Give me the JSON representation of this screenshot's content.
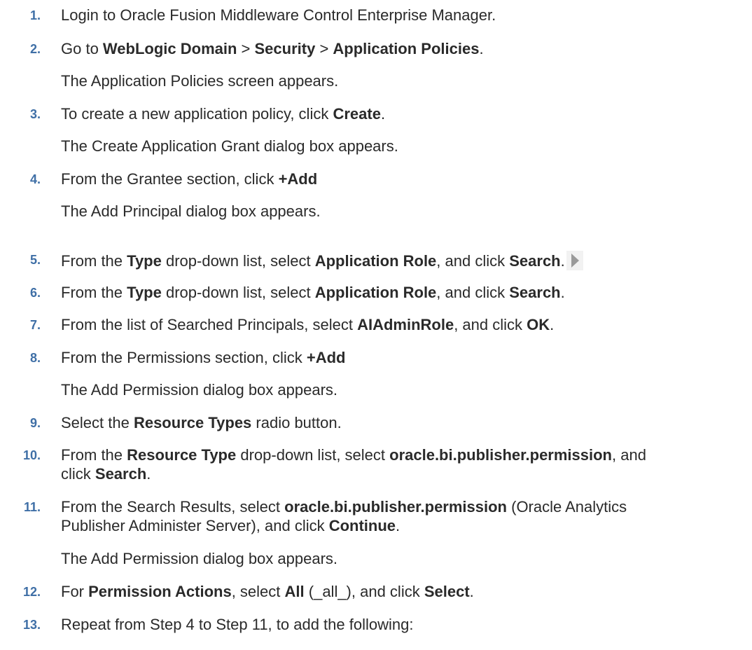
{
  "steps": [
    {
      "num": "1.",
      "parts": [
        "Login to Oracle Fusion Middleware Control Enterprise Manager."
      ]
    },
    {
      "num": "2.",
      "parts": [
        "Go to ",
        "WebLogic Domain",
        " > ",
        "Security",
        " > ",
        "Application Policies",
        "."
      ],
      "sub": "The Application Policies screen appears."
    },
    {
      "num": "3.",
      "parts": [
        "To create a new application policy, click ",
        "Create",
        "."
      ],
      "sub": "The Create Application Grant dialog box appears."
    },
    {
      "num": "4.",
      "parts": [
        "From the Grantee section, click ",
        "+Add"
      ],
      "sub": "The Add Principal dialog box appears."
    },
    {
      "num": "5.",
      "parts": [
        "From the ",
        "Type",
        " drop-down list, select ",
        "Application Role",
        ", and click ",
        "Search",
        "."
      ]
    },
    {
      "num": "6.",
      "parts": [
        "From the ",
        "Type",
        " drop-down list, select ",
        "Application Role",
        ", and click ",
        "Search",
        "."
      ]
    },
    {
      "num": "7.",
      "parts": [
        "From the list of Searched Principals, select ",
        "AIAdminRole",
        ", and click ",
        "OK",
        "."
      ]
    },
    {
      "num": "8.",
      "parts": [
        "From the Permissions section, click ",
        "+Add"
      ],
      "sub": "The Add Permission dialog box appears."
    },
    {
      "num": "9.",
      "parts": [
        "Select the ",
        "Resource Types",
        " radio button."
      ]
    },
    {
      "num": "10.",
      "parts": [
        "From the ",
        "Resource Type",
        " drop-down list, select ",
        "oracle.bi.publisher.permission",
        ", and"
      ],
      "parts2": [
        "click ",
        "Search",
        "."
      ]
    },
    {
      "num": "11.",
      "parts": [
        "From the Search Results, select ",
        "oracle.bi.publisher.permission",
        " (Oracle Analytics"
      ],
      "parts2": [
        "Publisher Administer Server), and click ",
        "Continue",
        "."
      ],
      "sub": "The Add Permission dialog box appears."
    },
    {
      "num": "12.",
      "parts": [
        "For ",
        "Permission Actions",
        ", select ",
        "All",
        " (_all_), and click ",
        "Select",
        "."
      ]
    },
    {
      "num": "13.",
      "parts": [
        "Repeat from Step 4 to Step 11, to add the following:"
      ]
    }
  ]
}
